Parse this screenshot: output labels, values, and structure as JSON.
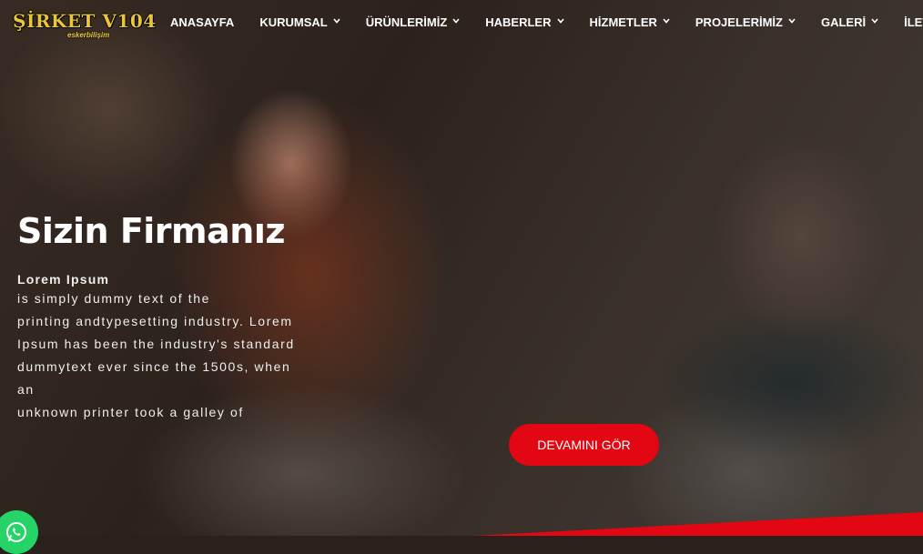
{
  "logo": {
    "name": "ŞİRKET V104",
    "tagline": "eskerbilişim"
  },
  "nav": [
    {
      "label": "ANASAYFA",
      "dropdown": false
    },
    {
      "label": "KURUMSAL",
      "dropdown": true
    },
    {
      "label": "ÜRÜNLERİMİZ",
      "dropdown": true
    },
    {
      "label": "HABERLER",
      "dropdown": true
    },
    {
      "label": "HİZMETLER",
      "dropdown": true
    },
    {
      "label": "PROJELERİMİZ",
      "dropdown": true
    },
    {
      "label": "GALERİ",
      "dropdown": true
    },
    {
      "label": "İLETİŞİM",
      "dropdown": false
    }
  ],
  "hero": {
    "title": "Sizin Firmanız",
    "lead_strong": "Lorem Ipsum",
    "lead_lines": [
      "is simply dummy text of the",
      "printing andtypesetting industry. Lorem",
      "Ipsum has been the industry's standard",
      "dummytext ever since the 1500s, when",
      "an",
      "unknown printer took a galley of"
    ],
    "cta_label": "DEVAMINI GÖR"
  },
  "colors": {
    "accent": "#e30613",
    "logo": "#e8c63a",
    "whatsapp": "#25d366"
  },
  "icons": {
    "whatsapp": "whatsapp-icon",
    "chevron": "chevron-down-icon"
  }
}
